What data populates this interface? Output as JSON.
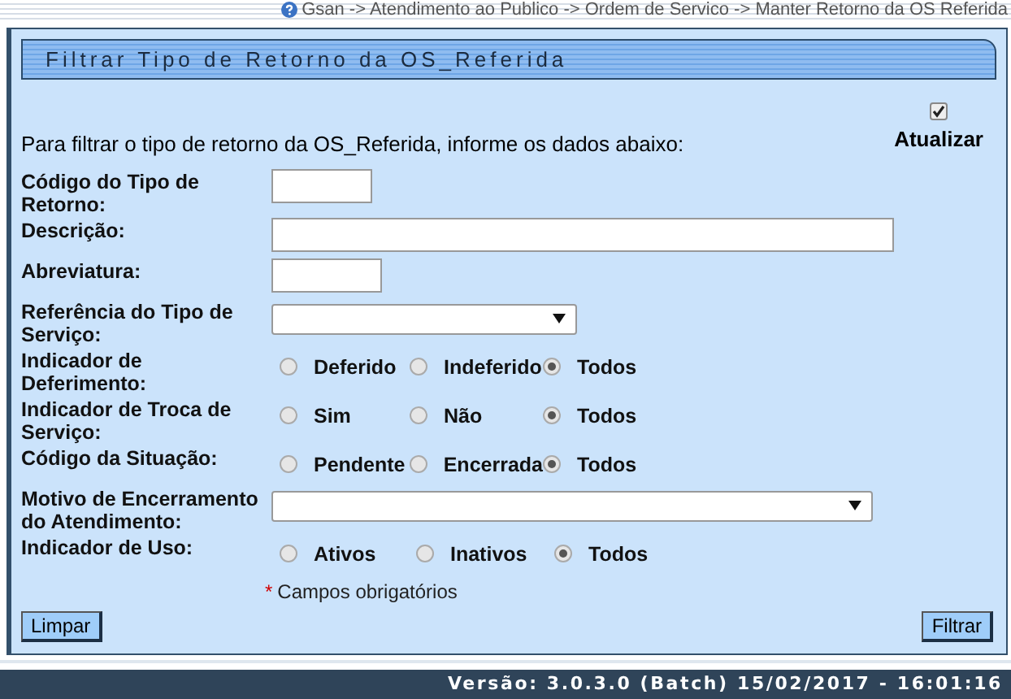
{
  "breadcrumb": "Gsan -> Atendimento ao Publico -> Ordem de Servico -> Manter Retorno da OS Referida",
  "panel_title": "Filtrar Tipo de Retorno da OS_Referida",
  "instructions": "Para filtrar o tipo de retorno da OS_Referida, informe os dados abaixo:",
  "atualizar": {
    "label": "Atualizar",
    "checked": true
  },
  "fields": [
    {
      "kind": "text",
      "label": "Código do Tipo de Retorno:"
    },
    {
      "kind": "text",
      "label": "Descrição:"
    },
    {
      "kind": "text",
      "label": "Abreviatura:"
    },
    {
      "kind": "select",
      "label": "Referência do Tipo de Serviço:"
    },
    {
      "kind": "radio",
      "label": "Indicador de Deferimento:",
      "options": [
        {
          "label": "Deferido",
          "selected": false
        },
        {
          "label": "Indeferido",
          "selected": false
        },
        {
          "label": "Todos",
          "selected": true
        }
      ]
    },
    {
      "kind": "radio",
      "label": "Indicador de Troca de Serviço:",
      "options": [
        {
          "label": "Sim",
          "selected": false
        },
        {
          "label": "Não",
          "selected": false
        },
        {
          "label": "Todos",
          "selected": true
        }
      ]
    },
    {
      "kind": "radio",
      "label": "Código da Situação:",
      "options": [
        {
          "label": "Pendente",
          "selected": false
        },
        {
          "label": "Encerrada",
          "selected": false
        },
        {
          "label": "Todos",
          "selected": true
        }
      ]
    },
    {
      "kind": "select",
      "label": "Motivo de Encerramento do Atendimento:"
    },
    {
      "kind": "radio",
      "label": "Indicador de Uso:",
      "options": [
        {
          "label": "Ativos",
          "selected": false
        },
        {
          "label": "Inativos",
          "selected": false
        },
        {
          "label": "Todos",
          "selected": true
        }
      ]
    }
  ],
  "required_mark": "*",
  "required_note": "Campos obrigatórios",
  "buttons": [
    "Limpar",
    "Filtrar"
  ],
  "version": "Versão: 3.0.3.0 (Batch) 15/02/2017 - 16:01:16"
}
